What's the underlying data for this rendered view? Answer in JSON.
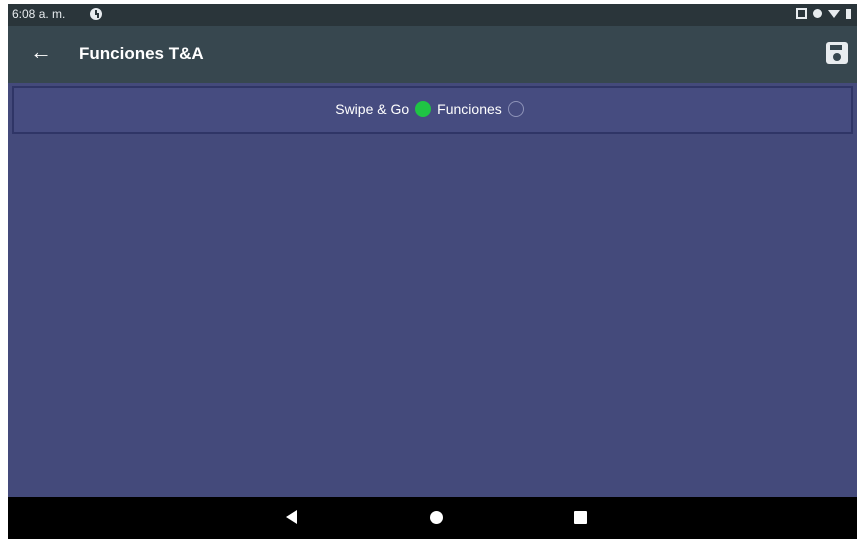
{
  "status_bar": {
    "time": "6:08 a. m.",
    "icons": [
      "clock-icon",
      "screenshot-icon",
      "vibrate-icon",
      "wifi-icon",
      "battery-icon"
    ]
  },
  "app_bar": {
    "title": "Funciones T&A",
    "back_icon": "arrow-back-icon",
    "save_icon": "save-icon"
  },
  "options": {
    "swipe_label": "Swipe & Go",
    "swipe_selected": true,
    "funciones_label": "Funciones",
    "funciones_selected": false
  },
  "nav_bar": {
    "icons": [
      "back-triangle-icon",
      "home-circle-icon",
      "recents-square-icon"
    ]
  },
  "colors": {
    "status_bar": "#2a353a",
    "app_bar": "#37474f",
    "content_bg": "#444a7b",
    "radio_selected": "#1fc444"
  }
}
